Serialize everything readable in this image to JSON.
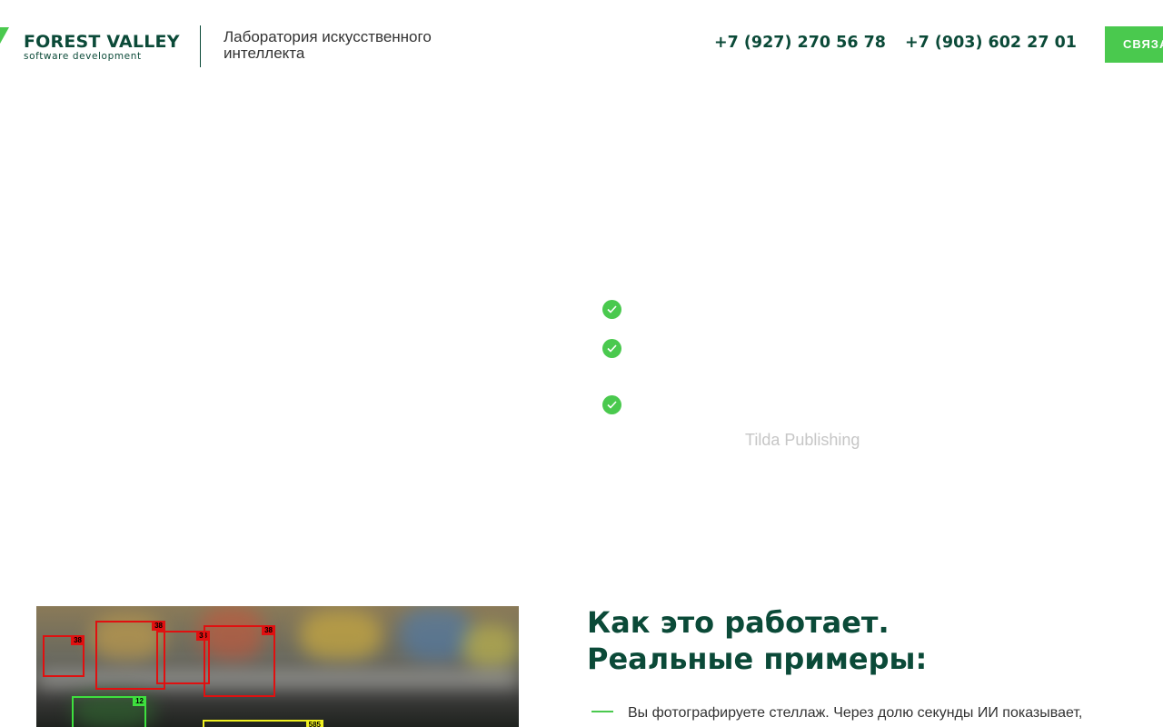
{
  "header": {
    "logo_title": "FOREST VALLEY",
    "logo_subtitle": "software  development",
    "tagline_line1": "Лаборатория искусственного",
    "tagline_line2": "интеллекта",
    "phone_1": "+7 (927) 270 56 78",
    "phone_2": "+7 (903) 602 27 01",
    "contact_button": "СВЯЗАТЬСЯ"
  },
  "watermark": "Tilda Publishing",
  "example_image": {
    "tags": [
      "38",
      "38",
      "38",
      "38",
      "12",
      "585"
    ]
  },
  "section": {
    "title_line1": "Как это работает.",
    "title_line2": "Реальные примеры:",
    "description": "Вы фотографируете стеллаж. Через долю секунды ИИ показывает,"
  },
  "colors": {
    "brand_dark": "#0b4a38",
    "brand_green": "#4ac94e"
  }
}
